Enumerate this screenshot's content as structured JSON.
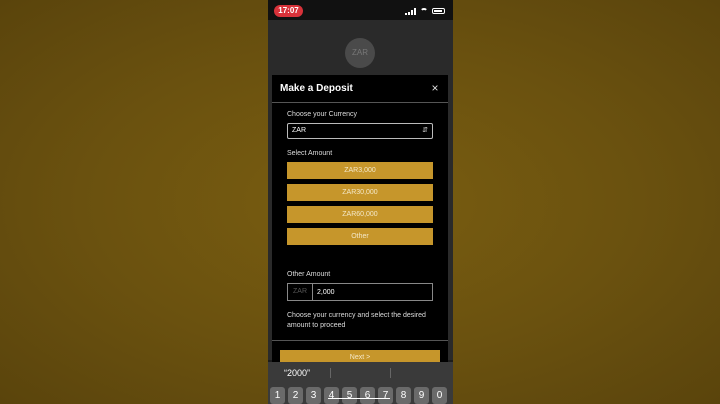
{
  "status_bar": {
    "time": "17:07"
  },
  "app": {
    "logo_text": "ZAR"
  },
  "modal": {
    "title": "Make a Deposit",
    "close_label": "×",
    "currency_label": "Choose your Currency",
    "currency_value": "ZAR",
    "select_amount_label": "Select Amount",
    "amount_options": [
      "ZAR3,000",
      "ZAR30,000",
      "ZAR60,000",
      "Other"
    ],
    "other_amount_label": "Other Amount",
    "other_amount_prefix": "ZAR",
    "other_amount_value": "2,000",
    "help_text": "Choose your currency and select the desired amount to proceed",
    "next_label": "Next >"
  },
  "keyboard": {
    "suggestion": "“2000”",
    "keys": [
      "1",
      "2",
      "3",
      "4",
      "5",
      "6",
      "7",
      "8",
      "9",
      "0"
    ]
  },
  "colors": {
    "accent": "#c6962b",
    "background": "#6a510f",
    "time_pill": "#d8323a"
  }
}
